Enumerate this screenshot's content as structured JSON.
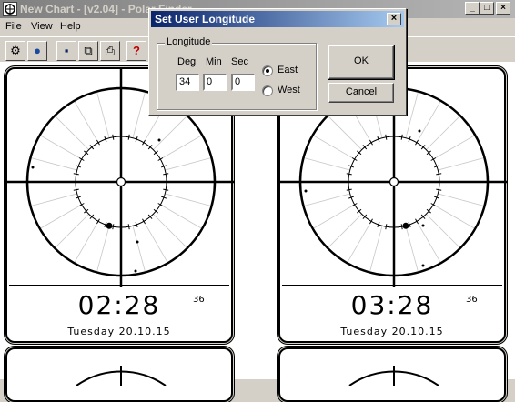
{
  "window": {
    "title": "New Chart - [v2.04] - Polar Finder",
    "minimize": "_",
    "maximize": "□",
    "close": "×"
  },
  "menu": {
    "items": [
      "File",
      "View",
      "Help"
    ]
  },
  "toolbar": {
    "buttons": [
      {
        "icon": "settings-icon",
        "glyph": "⚙"
      },
      {
        "icon": "globe-icon",
        "glyph": "●"
      },
      {
        "icon": "save-icon",
        "glyph": "▪"
      },
      {
        "icon": "copy-icon",
        "glyph": "⧉"
      },
      {
        "icon": "print-icon",
        "glyph": "⎙"
      },
      {
        "icon": "help-icon",
        "glyph": "?"
      }
    ]
  },
  "panels": [
    {
      "time": "02:28",
      "seconds": "36",
      "date": "Tuesday 20.10.15",
      "star_angle_deg": 195
    },
    {
      "time": "03:28",
      "seconds": "36",
      "date": "Tuesday 20.10.15",
      "star_angle_deg": 165
    },
    {
      "time": "",
      "seconds": "",
      "date": ""
    },
    {
      "time": "",
      "seconds": "",
      "date": ""
    }
  ],
  "dialog": {
    "title": "Set User Longitude",
    "close": "×",
    "group_label": "Longitude",
    "deg_label": "Deg",
    "min_label": "Min",
    "sec_label": "Sec",
    "deg_value": "34",
    "min_value": "0",
    "sec_value": "0",
    "east_label": "East",
    "west_label": "West",
    "selected": "East",
    "ok_label": "OK",
    "cancel_label": "Cancel"
  },
  "colors": {
    "dialog_title_start": "#0a246a",
    "dialog_title_end": "#a6caf0",
    "inactive_title": "#808080"
  }
}
